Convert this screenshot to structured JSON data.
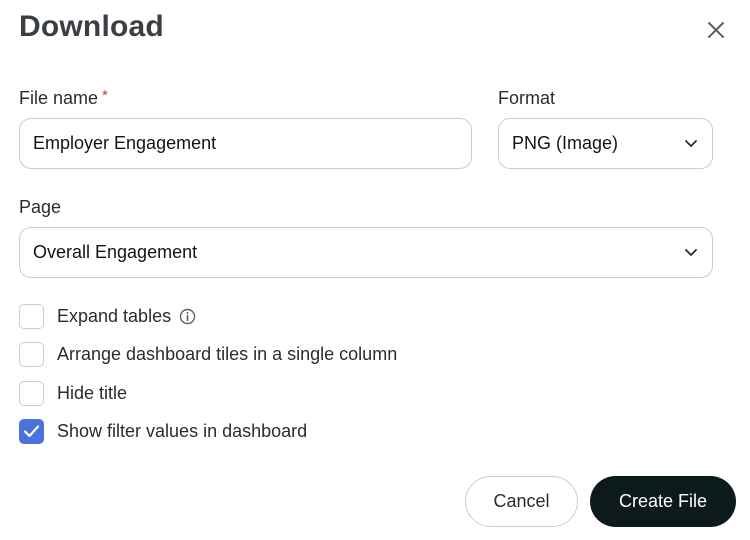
{
  "dialog": {
    "title": "Download",
    "close_icon": "close-icon"
  },
  "file_name": {
    "label": "File name",
    "required_mark": "*",
    "value": "Employer Engagement"
  },
  "format": {
    "label": "Format",
    "selected": "PNG (Image)",
    "icon": "chevron-down-icon"
  },
  "page": {
    "label": "Page",
    "selected": "Overall Engagement",
    "icon": "chevron-down-icon"
  },
  "options": [
    {
      "label": "Expand tables",
      "checked": false,
      "info_icon": "info-icon"
    },
    {
      "label": "Arrange dashboard tiles in a single column",
      "checked": false
    },
    {
      "label": "Hide title",
      "checked": false
    },
    {
      "label": "Show filter values in dashboard",
      "checked": true
    }
  ],
  "actions": {
    "cancel_label": "Cancel",
    "create_label": "Create File"
  },
  "colors": {
    "accent": "#4a72d9",
    "primary_button": "#0d1a1c",
    "required": "#d0342c"
  }
}
